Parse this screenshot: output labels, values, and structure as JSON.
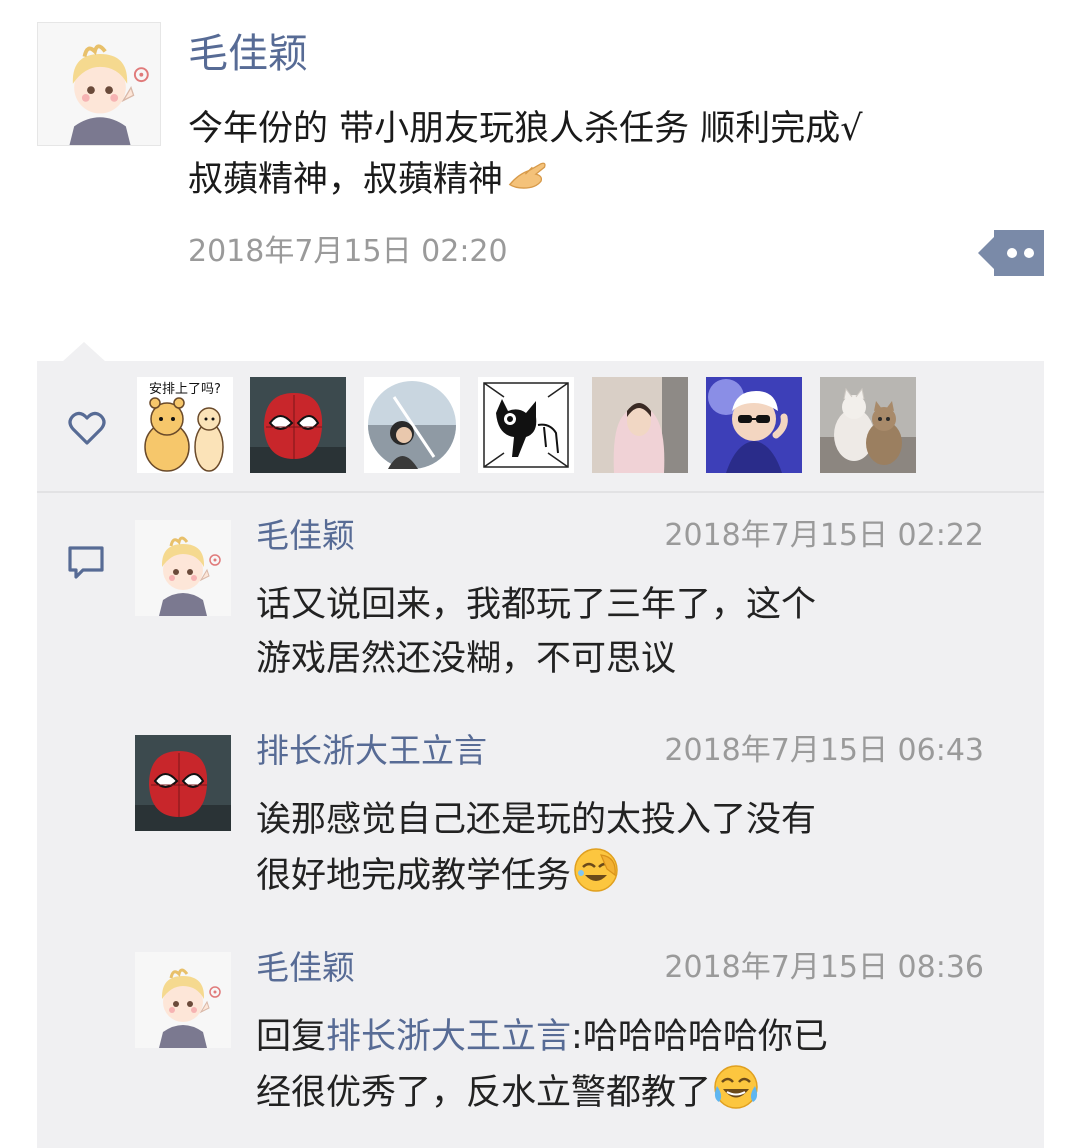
{
  "post": {
    "author": "毛佳颖",
    "text_lines": [
      "今年份的 带小朋友玩狼人杀任务 顺利完成√",
      "叔蘋精神，叔蘋精神"
    ],
    "time": "2018年7月15日 02:20",
    "trailing_emoji": "ok-hand-emoji"
  },
  "likes": {
    "icon": "heart-icon",
    "sticker_text": "安排上了吗?",
    "avatars": [
      "bear-sticker",
      "spiderman",
      "girl-portrait",
      "black-cat-drawing",
      "girl-pink-hoodie",
      "cartoon-boy-sunglasses",
      "cats-photo"
    ]
  },
  "comments": [
    {
      "name": "毛佳颖",
      "time": "2018年7月15日 02:22",
      "lines": [
        "话又说回来，我都玩了三年了，这个",
        "游戏居然还没糊，不可思议"
      ]
    },
    {
      "name": "排长浙大王立言",
      "time": "2018年7月15日 06:43",
      "lines": [
        "诶那感觉自己还是玩的太投入了没有",
        "很好地完成教学任务"
      ],
      "emoji": "facepalm-laugh-emoji"
    },
    {
      "name": "毛佳颖",
      "time": "2018年7月15日 08:36",
      "reply_prefix": "回复",
      "reply_to": "排长浙大王立言",
      "reply_rest": ":哈哈哈哈哈你已",
      "line2": "经很优秀了，反水立警都教了",
      "emoji": "tears-of-joy-emoji"
    }
  ],
  "colors": {
    "link": "#576b95",
    "panel": "#f0f0f2",
    "time": "#9a9a9a"
  }
}
